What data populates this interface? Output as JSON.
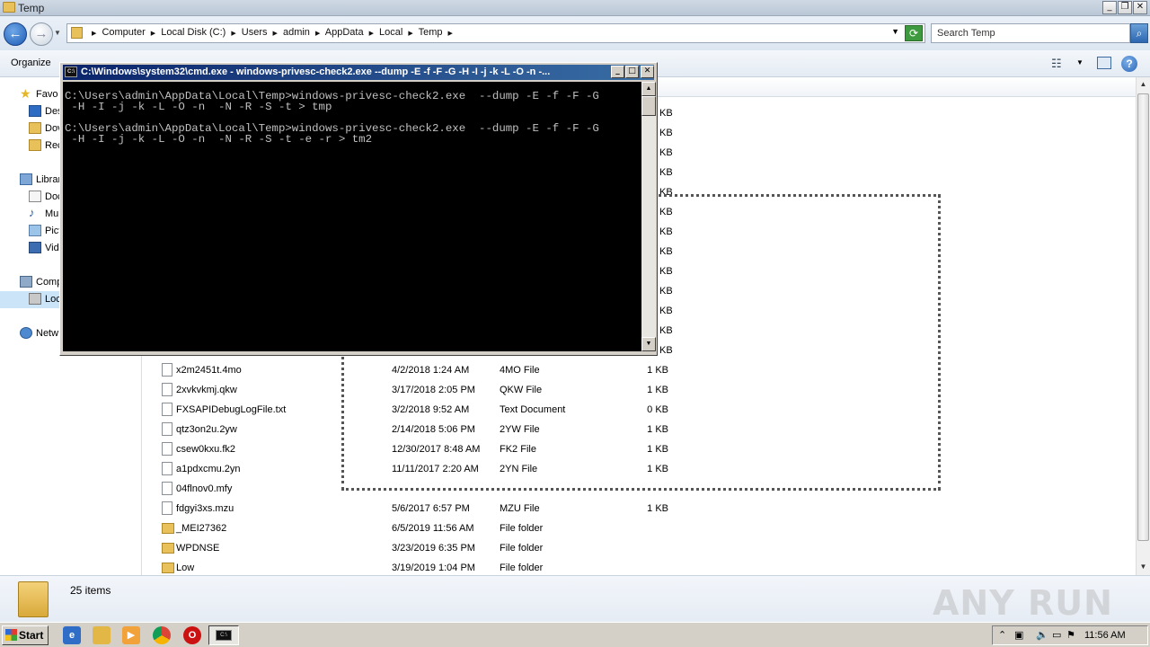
{
  "window": {
    "title": "Temp"
  },
  "address": {
    "crumbs": [
      "Computer",
      "Local Disk (C:)",
      "Users",
      "admin",
      "AppData",
      "Local",
      "Temp"
    ]
  },
  "search": {
    "placeholder": "Search Temp"
  },
  "commandbar": {
    "organize": "Organize"
  },
  "nav": {
    "items": [
      {
        "label": "Favo",
        "icon": "star-icon"
      },
      {
        "label": "Des",
        "icon": "desktop-icon"
      },
      {
        "label": "Dov",
        "icon": "downloads-icon"
      },
      {
        "label": "Rec",
        "icon": "recent-places-icon"
      },
      {
        "label": "Librar",
        "icon": "libraries-icon"
      },
      {
        "label": "Doc",
        "icon": "documents-icon"
      },
      {
        "label": "Mu:",
        "icon": "music-icon"
      },
      {
        "label": "Pict",
        "icon": "pictures-icon"
      },
      {
        "label": "Vide",
        "icon": "videos-icon"
      },
      {
        "label": "Comp",
        "icon": "computer-icon"
      },
      {
        "label": "Loc",
        "icon": "local-disk-icon"
      },
      {
        "label": "Netw",
        "icon": "network-icon"
      }
    ]
  },
  "files": [
    {
      "name": "x2m2451t.4mo",
      "date": "4/2/2018 1:24 AM",
      "type": "4MO File",
      "size": "1 KB",
      "kind": "file"
    },
    {
      "name": "2xvkvkmj.qkw",
      "date": "3/17/2018 2:05 PM",
      "type": "QKW File",
      "size": "1 KB",
      "kind": "file"
    },
    {
      "name": "FXSAPIDebugLogFile.txt",
      "date": "3/2/2018 9:52 AM",
      "type": "Text Document",
      "size": "0 KB",
      "kind": "file"
    },
    {
      "name": "qtz3on2u.2yw",
      "date": "2/14/2018 5:06 PM",
      "type": "2YW File",
      "size": "1 KB",
      "kind": "file"
    },
    {
      "name": "csew0kxu.fk2",
      "date": "12/30/2017 8:48 AM",
      "type": "FK2 File",
      "size": "1 KB",
      "kind": "file"
    },
    {
      "name": "a1pdxcmu.2yn",
      "date": "11/11/2017 2:20 AM",
      "type": "2YN File",
      "size": "1 KB",
      "kind": "file"
    },
    {
      "name": "04flnov0.mfy",
      "date": "",
      "type": "",
      "size": "",
      "kind": "file"
    },
    {
      "name": "fdgyi3xs.mzu",
      "date": "5/6/2017 6:57 PM",
      "type": "MZU File",
      "size": "1 KB",
      "kind": "file"
    },
    {
      "name": "_MEI27362",
      "date": "6/5/2019 11:56 AM",
      "type": "File folder",
      "size": "",
      "kind": "folder"
    },
    {
      "name": "WPDNSE",
      "date": "3/23/2019 6:35 PM",
      "type": "File folder",
      "size": "",
      "kind": "folder"
    },
    {
      "name": "Low",
      "date": "3/19/2019 1:04 PM",
      "type": "File folder",
      "size": "",
      "kind": "folder"
    }
  ],
  "partial_sizes": [
    "KB",
    "KB",
    "KB",
    "KB",
    "KB",
    "KB",
    "KB",
    "KB",
    "KB",
    "KB",
    "KB",
    "KB",
    "KB"
  ],
  "details": {
    "count": "25 items",
    "watermark": "ANY RUN"
  },
  "cmd": {
    "title": "C:\\Windows\\system32\\cmd.exe - windows-privesc-check2.exe  --dump -E -f -F -G -H -I -j -k -L -O -n -...",
    "lines": [
      "C:\\Users\\admin\\AppData\\Local\\Temp>windows-privesc-check2.exe  --dump -E -f -F -G",
      " -H -I -j -k -L -O -n  -N -R -S -t > tmp",
      "",
      "C:\\Users\\admin\\AppData\\Local\\Temp>windows-privesc-check2.exe  --dump -E -f -F -G",
      " -H -I -j -k -L -O -n  -N -R -S -t -e -r > tm2"
    ]
  },
  "taskbar": {
    "start": "Start",
    "clock": "11:56 AM"
  }
}
